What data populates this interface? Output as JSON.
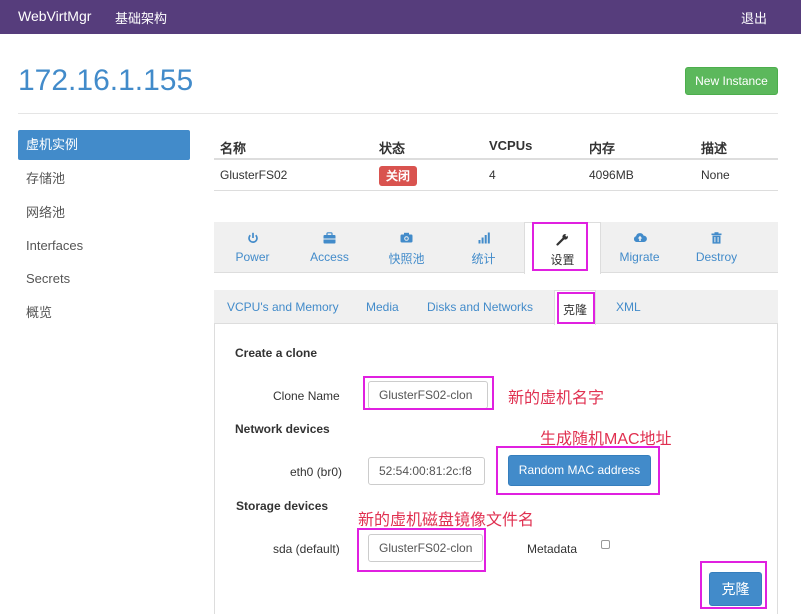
{
  "navbar": {
    "brand": "WebVirtMgr",
    "infrastructure": "基础架构",
    "logout": "退出"
  },
  "header": {
    "host": "172.16.1.155",
    "new_instance": "New Instance"
  },
  "sidebar": {
    "items": [
      {
        "label": "虚机实例",
        "active": true
      },
      {
        "label": "存储池"
      },
      {
        "label": "网络池"
      },
      {
        "label": "Interfaces"
      },
      {
        "label": "Secrets"
      },
      {
        "label": "概览"
      }
    ]
  },
  "instance_table": {
    "headers": [
      "名称",
      "状态",
      "VCPUs",
      "内存",
      "描述"
    ],
    "row": {
      "name": "GlusterFS02",
      "status": "关闭",
      "vcpus": "4",
      "memory": "4096MB",
      "description": "None"
    },
    "status_color": "#d9534f"
  },
  "actions": {
    "tabs": [
      {
        "label": "Power",
        "icon": "power-icon"
      },
      {
        "label": "Access",
        "icon": "briefcase-icon"
      },
      {
        "label": "快照池",
        "icon": "camera-icon"
      },
      {
        "label": "统计",
        "icon": "stats-icon"
      },
      {
        "label": "设置",
        "icon": "wrench-icon",
        "active": true
      },
      {
        "label": "Migrate",
        "icon": "cloud-upload-icon"
      },
      {
        "label": "Destroy",
        "icon": "trash-icon"
      }
    ]
  },
  "settings": {
    "tabs": [
      {
        "label": "VCPU's and Memory"
      },
      {
        "label": "Media"
      },
      {
        "label": "Disks and Networks"
      },
      {
        "label": "克隆",
        "active": true
      },
      {
        "label": "XML"
      }
    ]
  },
  "clone": {
    "title": "Create a clone",
    "clone_name_label": "Clone Name",
    "clone_name_value": "GlusterFS02-clon",
    "network_title": "Network devices",
    "eth_label": "eth0 (br0)",
    "mac_value": "52:54:00:81:2c:f8",
    "random_mac_button": "Random MAC address",
    "storage_title": "Storage devices",
    "disk_label": "sda (default)",
    "disk_value": "GlusterFS02-clon",
    "metadata_label": "Metadata",
    "metadata_checked": false,
    "submit": "克隆"
  },
  "annotations": {
    "vm_name": "新的虚机名字",
    "random_mac": "生成随机MAC地址",
    "disk_image": "新的虚机磁盘镜像文件名",
    "highlight_color": "#e020e0",
    "text_color": "#e03050"
  }
}
